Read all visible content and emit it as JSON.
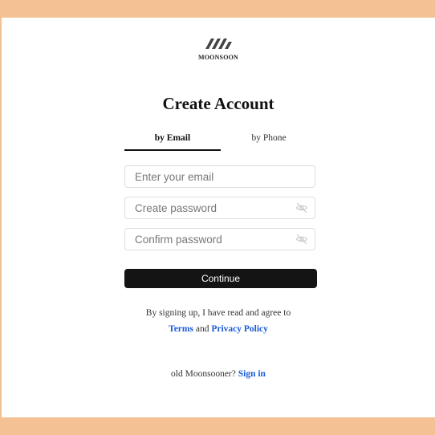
{
  "brand": {
    "name": "MOONSOON",
    "logo_icon": "moonsoon-stripes-logo"
  },
  "title": "Create Account",
  "tabs": [
    {
      "label": "by Email",
      "active": true
    },
    {
      "label": "by Phone",
      "active": false
    }
  ],
  "form": {
    "email": {
      "placeholder": "Enter your email",
      "value": ""
    },
    "password": {
      "placeholder": "Create password",
      "value": "",
      "toggle_icon": "eye-slash-icon"
    },
    "confirm": {
      "placeholder": "Confirm password",
      "value": "",
      "toggle_icon": "eye-slash-icon"
    },
    "submit_label": "Continue"
  },
  "legal": {
    "prefix": "By signing up, I have read and agree to",
    "terms": "Terms",
    "and": "and",
    "privacy": "Privacy Policy"
  },
  "signin": {
    "prompt": "old Moonsooner?",
    "link": "Sign in"
  },
  "colors": {
    "page_border": "#f3c193",
    "primary_button": "#141414",
    "link": "#1a5bd6"
  }
}
